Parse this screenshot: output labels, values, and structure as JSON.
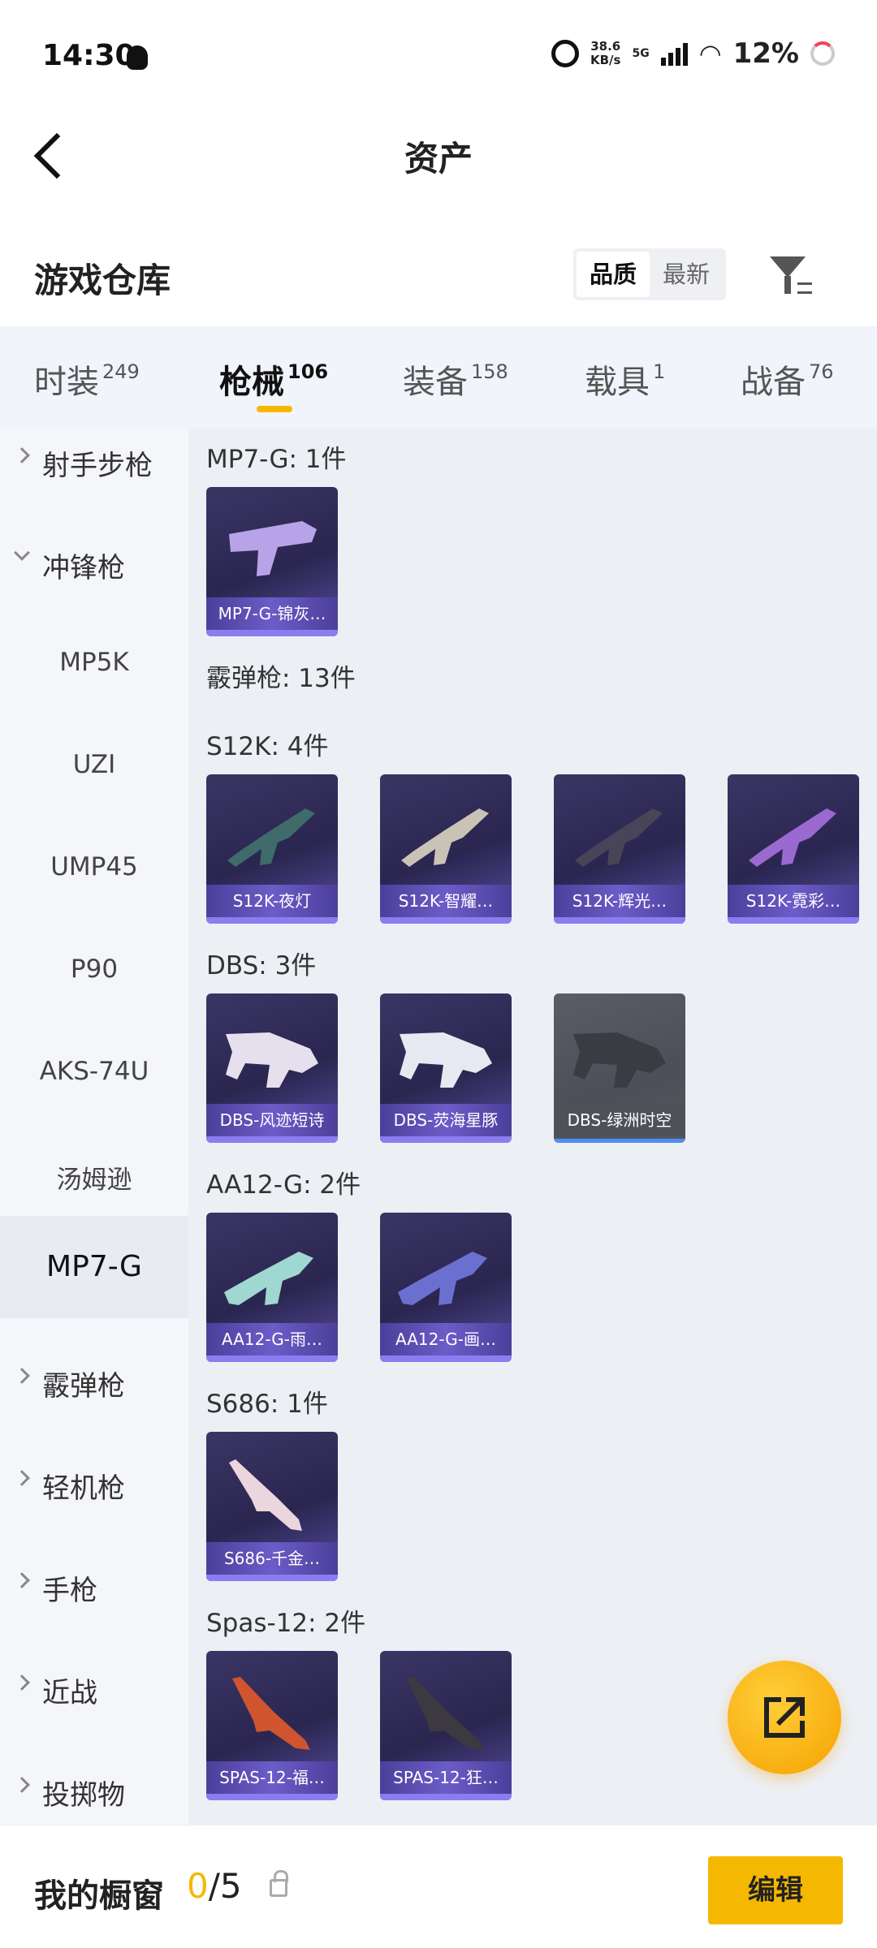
{
  "status_bar": {
    "time": "14:30",
    "speed_value": "38.6",
    "speed_unit": "KB/s",
    "network": "5G",
    "battery": "12%"
  },
  "header": {
    "title": "资产"
  },
  "warehouse": {
    "title": "游戏仓库",
    "sort_options": [
      "品质",
      "最新"
    ],
    "active_sort": "品质"
  },
  "tabs": [
    {
      "label": "时装",
      "count": "249"
    },
    {
      "label": "枪械",
      "count": "106"
    },
    {
      "label": "装备",
      "count": "158"
    },
    {
      "label": "载具",
      "count": "1"
    },
    {
      "label": "战备",
      "count": "76"
    }
  ],
  "active_tab": "枪械",
  "sidebar": {
    "items": [
      {
        "label": "射手步枪",
        "type": "category",
        "expanded": false
      },
      {
        "label": "冲锋枪",
        "type": "category",
        "expanded": true
      },
      {
        "label": "MP5K",
        "type": "sub"
      },
      {
        "label": "UZI",
        "type": "sub"
      },
      {
        "label": "UMP45",
        "type": "sub"
      },
      {
        "label": "P90",
        "type": "sub"
      },
      {
        "label": "AKS-74U",
        "type": "sub"
      },
      {
        "label": "汤姆逊",
        "type": "sub"
      },
      {
        "label": "MP7-G",
        "type": "sub",
        "selected": true
      },
      {
        "label": "霰弹枪",
        "type": "category",
        "expanded": false
      },
      {
        "label": "轻机枪",
        "type": "category",
        "expanded": false
      },
      {
        "label": "手枪",
        "type": "category",
        "expanded": false
      },
      {
        "label": "近战",
        "type": "category",
        "expanded": false
      },
      {
        "label": "投掷物",
        "type": "category",
        "expanded": false
      }
    ]
  },
  "sections": {
    "mp7g": {
      "title": "MP7-G: 1件",
      "items": [
        {
          "name": "MP7-G-锦灰…",
          "color": "#b9a3e8"
        }
      ]
    },
    "shotgun": {
      "title": "霰弹枪: 13件"
    },
    "s12k": {
      "title": "S12K: 4件",
      "items": [
        {
          "name": "S12K-夜灯",
          "color": "#3f6b6a"
        },
        {
          "name": "S12K-智耀…",
          "color": "#c9c3b5"
        },
        {
          "name": "S12K-辉光…",
          "color": "#4a4458"
        },
        {
          "name": "S12K-霓彩…",
          "color": "#9a6ad0"
        }
      ]
    },
    "dbs": {
      "title": "DBS: 3件",
      "items": [
        {
          "name": "DBS-风迹短诗",
          "color": "#e6e0ee",
          "grey": false
        },
        {
          "name": "DBS-荧海星豚",
          "color": "#e8e8f2",
          "grey": false
        },
        {
          "name": "DBS-绿洲时空",
          "color": "#3a3c44",
          "grey": true
        }
      ]
    },
    "aa12g": {
      "title": "AA12-G: 2件",
      "items": [
        {
          "name": "AA12-G-雨…",
          "color": "#9fd8d0"
        },
        {
          "name": "AA12-G-画…",
          "color": "#6b6fd0"
        }
      ]
    },
    "s686": {
      "title": "S686: 1件",
      "items": [
        {
          "name": "S686-千金…",
          "color": "#ead6dc"
        }
      ]
    },
    "spas12": {
      "title": "Spas-12: 2件",
      "items": [
        {
          "name": "SPAS-12-福…",
          "color": "#d0542e"
        },
        {
          "name": "SPAS-12-狂…",
          "color": "#3c3a40"
        }
      ]
    }
  },
  "bottom_bar": {
    "title": "我的橱窗",
    "current": "0",
    "separator": "/5",
    "edit_label": "编辑"
  },
  "colors": {
    "accent": "#f5b800",
    "card_bg": "#2a2650",
    "card_label": "#6c5cc8"
  }
}
